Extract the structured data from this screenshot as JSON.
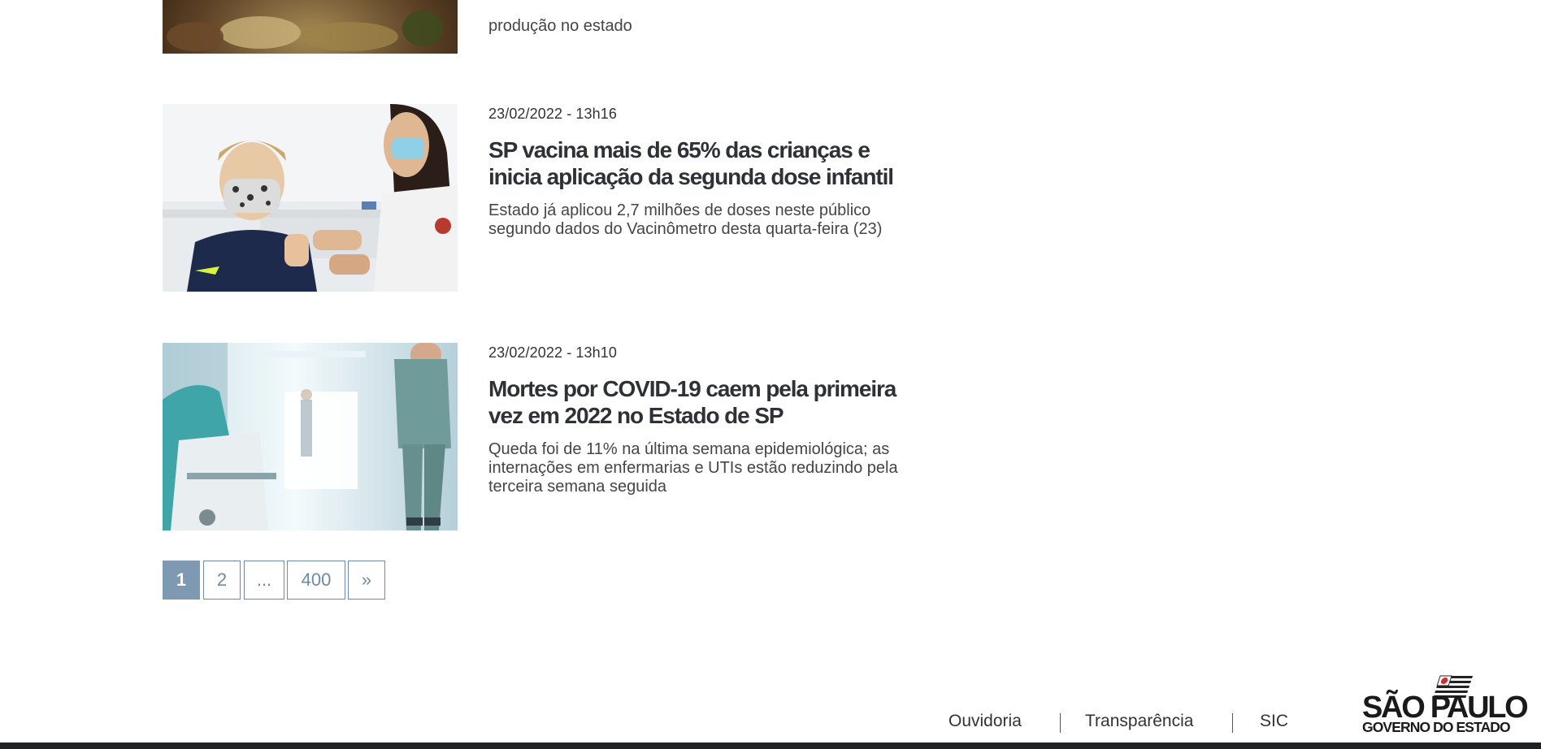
{
  "news": {
    "partial_item": {
      "description": "produção no estado"
    },
    "items": [
      {
        "date": "23/02/2022 - 13h16",
        "title": "SP vacina mais de 65% das crianças e inicia aplicação da segunda dose infantil",
        "description": "Estado já aplicou 2,7 milhões de doses neste público segundo dados do Vacinômetro desta quarta-feira (23)"
      },
      {
        "date": "23/02/2022 - 13h10",
        "title": "Mortes por COVID-19 caem pela primeira vez em 2022 no Estado de SP",
        "description": "Queda foi de 11% na última semana epidemiológica; as internações em enfermarias e UTIs estão reduzindo pela terceira semana seguida"
      }
    ]
  },
  "pagination": {
    "pages": [
      "1",
      "2",
      "...",
      "400",
      "»"
    ],
    "current": "1"
  },
  "footer": {
    "links": [
      "Ouvidoria",
      "Transparência",
      "SIC"
    ],
    "logo": {
      "line1": "SÃO PAULO",
      "line2": "GOVERNO DO ESTADO"
    }
  },
  "colors": {
    "pagination_active": "#7e9ab2",
    "pagination_border": "#6d8aa8",
    "bottom_bar": "#1f2224"
  }
}
